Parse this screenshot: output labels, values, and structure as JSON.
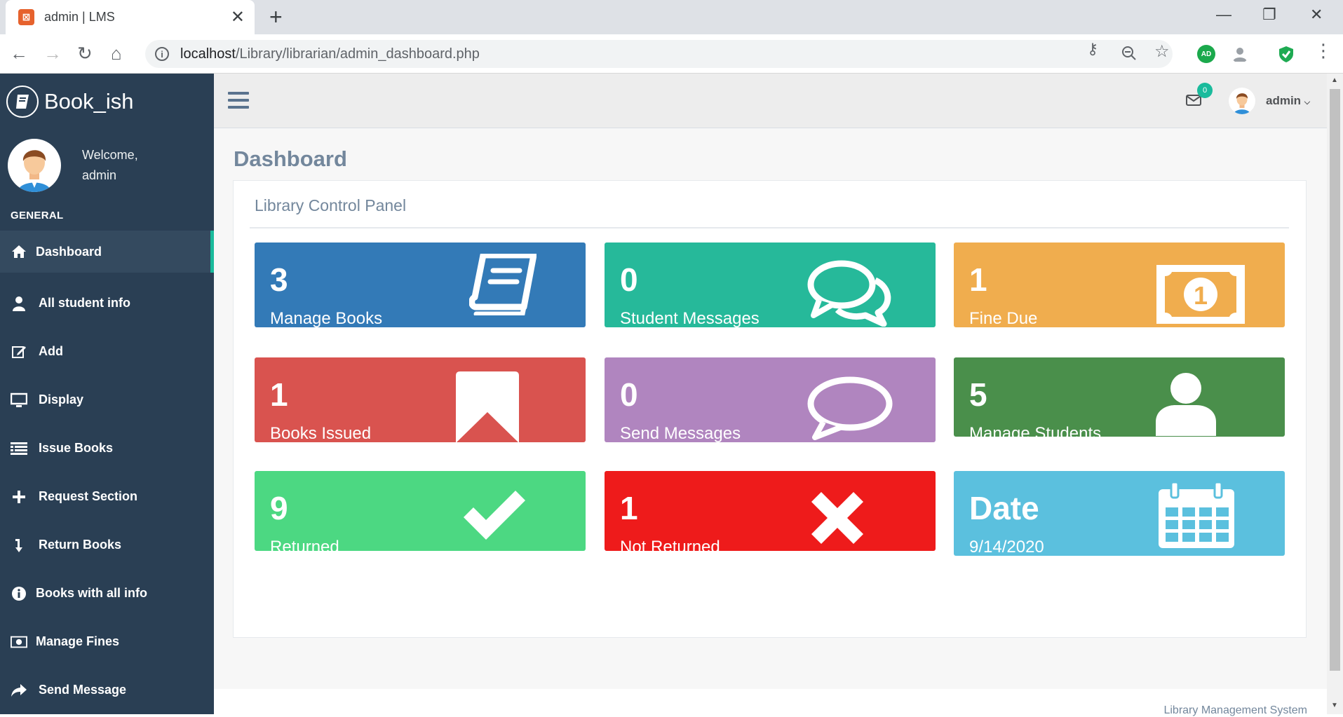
{
  "browser": {
    "tab_title": "admin | LMS",
    "tab_favicon": "xampp-icon",
    "url_host": "localhost",
    "url_path": "/Library/librarian/admin_dashboard.php",
    "extensions": [
      "key-icon",
      "zoom-icon",
      "star-icon",
      "adguard-extension",
      "profile-extension",
      "shield-extension",
      "menu-icon"
    ],
    "ext_ad_label": "AD"
  },
  "sidebar": {
    "brand": "Book_ish",
    "welcome": "Welcome,",
    "username": "admin",
    "section": "GENERAL",
    "items": [
      {
        "label": "Dashboard",
        "icon": "home-icon"
      },
      {
        "label": "All student info",
        "icon": "user-icon"
      },
      {
        "label": "Add",
        "icon": "edit-icon"
      },
      {
        "label": "Display",
        "icon": "monitor-icon"
      },
      {
        "label": "Issue Books",
        "icon": "list-icon"
      },
      {
        "label": "Request Section",
        "icon": "plus-icon"
      },
      {
        "label": "Return Books",
        "icon": "arrow-down-icon"
      },
      {
        "label": "Books with all info",
        "icon": "info-icon"
      },
      {
        "label": "Manage Fines",
        "icon": "money-icon"
      },
      {
        "label": "Send Message",
        "icon": "share-icon"
      }
    ]
  },
  "header": {
    "mail_count": "0",
    "user": "admin"
  },
  "main": {
    "title": "Dashboard",
    "panel_title": "Library Control Panel",
    "tiles": [
      {
        "value": "3",
        "label": "Manage Books",
        "color": "#337ab7",
        "icon": "book-icon"
      },
      {
        "value": "0",
        "label": "Student Messages",
        "color": "#26b99a",
        "icon": "comments-icon"
      },
      {
        "value": "1",
        "label": "Fine Due",
        "color": "#f0ad4e",
        "icon": "money-bill-icon"
      },
      {
        "value": "1",
        "label": "Books Issued",
        "color": "#d9534f",
        "icon": "bookmark-icon"
      },
      {
        "value": "0",
        "label": "Send Messages",
        "color": "#b085bf",
        "icon": "comment-icon"
      },
      {
        "value": "5",
        "label": "Manage Students",
        "color": "#4a8f4b",
        "icon": "user-icon"
      },
      {
        "value": "9",
        "label": "Returned",
        "color": "#4cd882",
        "icon": "check-icon"
      },
      {
        "value": "1",
        "label": "Not Returned",
        "color": "#ee1b1b",
        "icon": "times-icon"
      },
      {
        "value": "Date",
        "label": "9/14/2020",
        "color": "#5bc0de",
        "icon": "calendar-icon"
      }
    ],
    "footer": "Library Management System"
  }
}
